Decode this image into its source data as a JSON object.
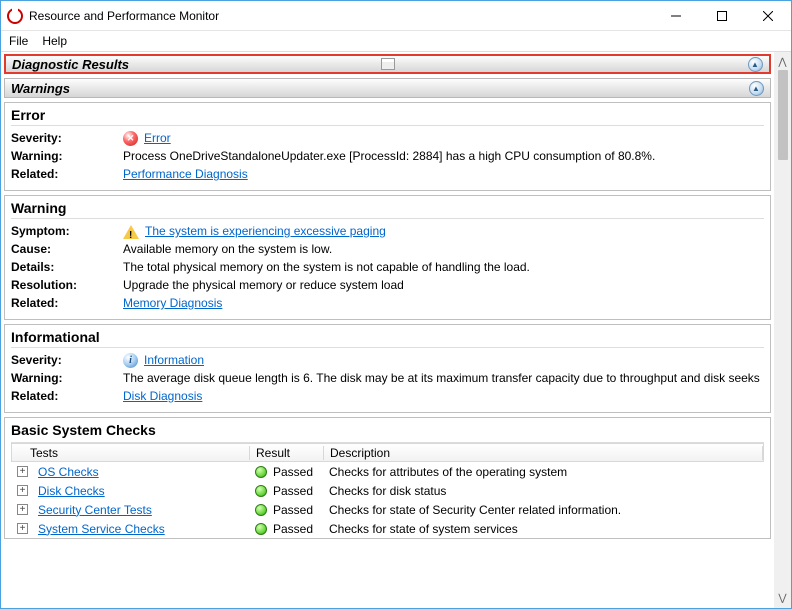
{
  "window": {
    "title": "Resource and Performance Monitor"
  },
  "menu": {
    "file": "File",
    "help": "Help"
  },
  "sections": {
    "diagnostic": "Diagnostic Results",
    "warnings": "Warnings"
  },
  "error_panel": {
    "title": "Error",
    "k_severity": "Severity:",
    "v_severity": "Error",
    "k_warning": "Warning:",
    "v_warning": "Process OneDriveStandaloneUpdater.exe [ProcessId: 2884] has a high CPU consumption of 80.8%.",
    "k_related": "Related:",
    "v_related": "Performance Diagnosis"
  },
  "warning_panel": {
    "title": "Warning",
    "k_symptom": "Symptom:",
    "v_symptom": "The system is experiencing excessive paging",
    "k_cause": "Cause:",
    "v_cause": "Available memory on the system is low.",
    "k_details": "Details:",
    "v_details": "The total physical memory on the system is not capable of handling the load.",
    "k_resolution": "Resolution:",
    "v_resolution": "Upgrade the physical memory or reduce system load",
    "k_related": "Related:",
    "v_related": "Memory Diagnosis"
  },
  "info_panel": {
    "title": "Informational",
    "k_severity": "Severity:",
    "v_severity": "Information",
    "k_warning": "Warning:",
    "v_warning": "The average disk queue length is 6. The disk may be at its maximum transfer capacity due to throughput and disk seeks",
    "k_related": "Related:",
    "v_related": "Disk Diagnosis"
  },
  "checks": {
    "title": "Basic System Checks",
    "col_tests": "Tests",
    "col_result": "Result",
    "col_desc": "Description",
    "rows": [
      {
        "name": "OS Checks",
        "result": "Passed",
        "desc": "Checks for attributes of the operating system"
      },
      {
        "name": "Disk Checks",
        "result": "Passed",
        "desc": "Checks for disk status"
      },
      {
        "name": "Security Center Tests",
        "result": "Passed",
        "desc": "Checks for state of Security Center related information."
      },
      {
        "name": "System Service Checks",
        "result": "Passed",
        "desc": "Checks for state of system services"
      }
    ]
  }
}
